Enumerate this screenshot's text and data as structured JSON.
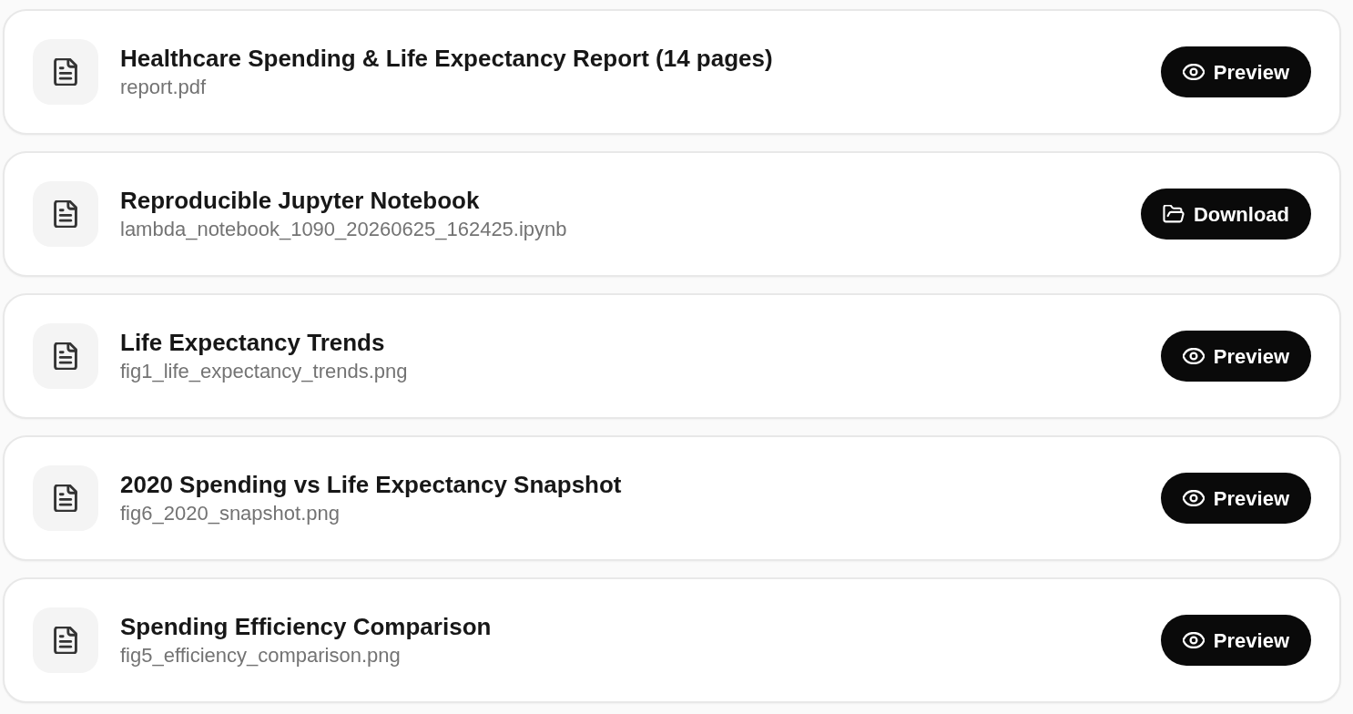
{
  "files": [
    {
      "title": "Healthcare Spending & Life Expectancy Report (14 pages)",
      "filename": "report.pdf",
      "action": {
        "kind": "preview",
        "label": "Preview"
      }
    },
    {
      "title": "Reproducible Jupyter Notebook",
      "filename": "lambda_notebook_1090_20260625_162425.ipynb",
      "action": {
        "kind": "download",
        "label": "Download"
      }
    },
    {
      "title": "Life Expectancy Trends",
      "filename": "fig1_life_expectancy_trends.png",
      "action": {
        "kind": "preview",
        "label": "Preview"
      }
    },
    {
      "title": "2020 Spending vs Life Expectancy Snapshot",
      "filename": "fig6_2020_snapshot.png",
      "action": {
        "kind": "preview",
        "label": "Preview"
      }
    },
    {
      "title": "Spending Efficiency Comparison",
      "filename": "fig5_efficiency_comparison.png",
      "action": {
        "kind": "preview",
        "label": "Preview"
      }
    }
  ]
}
